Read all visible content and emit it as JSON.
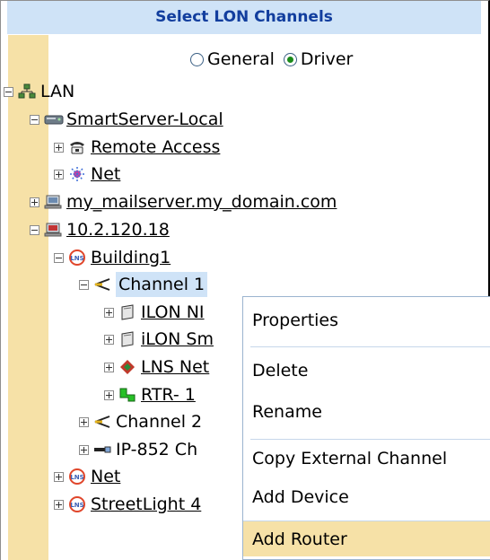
{
  "header": {
    "title": "Select LON Channels"
  },
  "mode": {
    "general_label": "General",
    "driver_label": "Driver",
    "selected": "Driver"
  },
  "tree": {
    "lan": "LAN",
    "smartserver": "SmartServer-Local",
    "remote_access": "Remote Access",
    "net_1": "Net",
    "mailserver": "my_mailserver.my_domain.com",
    "ip_node": "10.2.120.18",
    "building": "Building1",
    "channel1": "Channel 1",
    "ilon_ni": "ILON NI",
    "ilon_sm": "iLON Sm",
    "lns_net": "LNS Net",
    "rtr1": "RTR- 1",
    "channel2": "Channel 2",
    "ip852": "IP-852 Ch",
    "net_2": "Net",
    "streetlight": "StreetLight 4"
  },
  "context_menu": {
    "items": [
      "Properties",
      "Delete",
      "Rename",
      "Copy External Channel",
      "Add Device",
      "Add Router"
    ],
    "highlighted": "Add Router"
  }
}
